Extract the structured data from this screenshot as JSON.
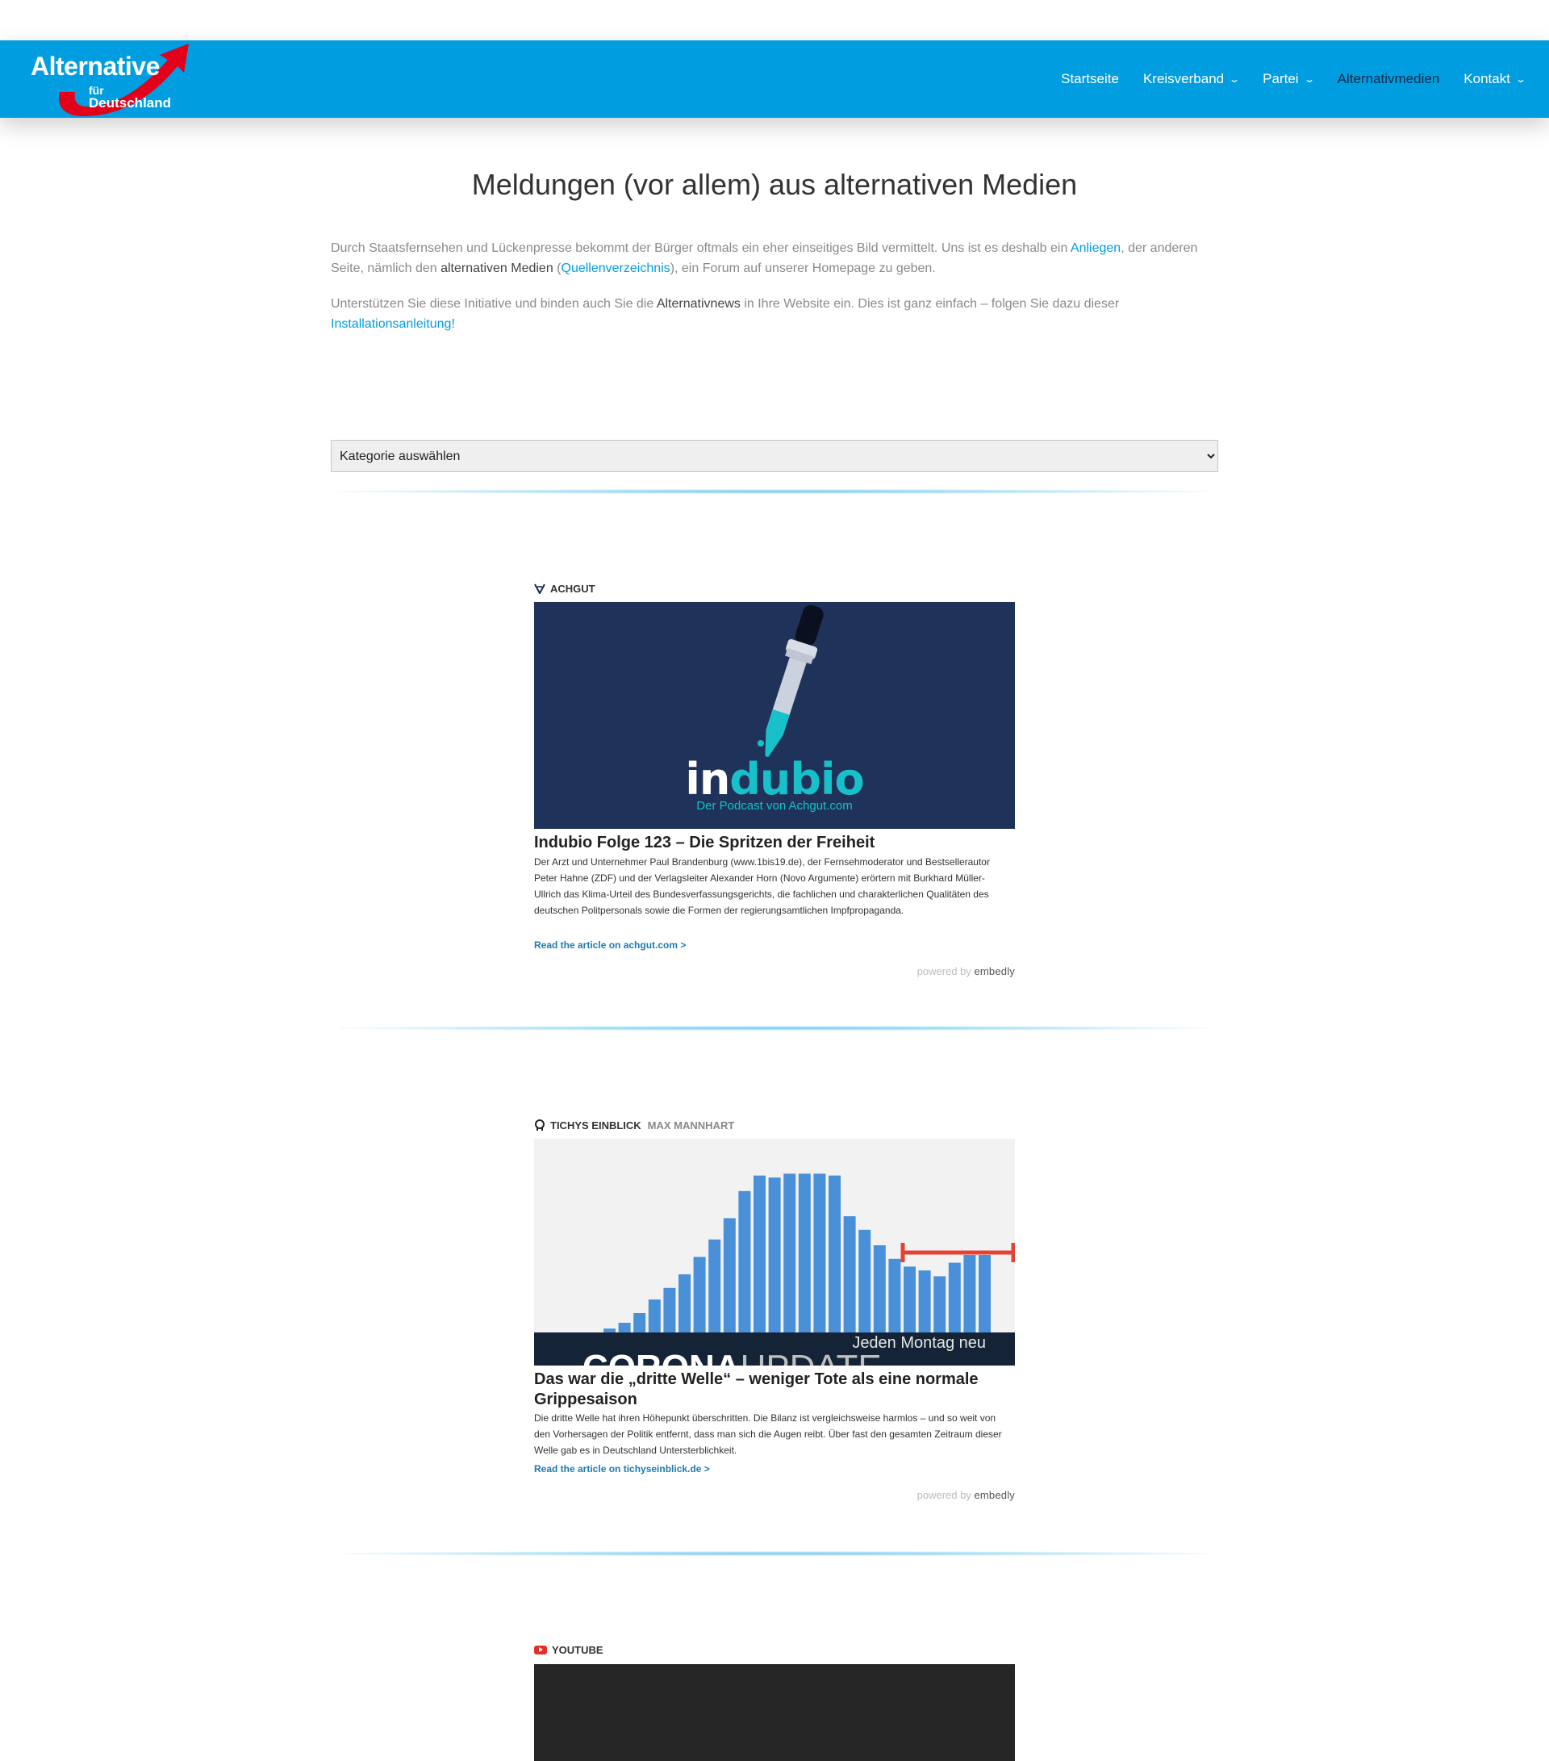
{
  "header": {
    "logo": {
      "line1": "Alternative",
      "line2": "für",
      "line3": "Deutschland"
    },
    "nav": [
      {
        "label": "Startseite",
        "has_dropdown": false,
        "active": false
      },
      {
        "label": "Kreisverband",
        "has_dropdown": true,
        "active": false
      },
      {
        "label": "Partei",
        "has_dropdown": true,
        "active": false
      },
      {
        "label": "Alternativmedien",
        "has_dropdown": false,
        "active": true
      },
      {
        "label": "Kontakt",
        "has_dropdown": true,
        "active": false
      }
    ]
  },
  "page": {
    "title": "Meldungen (vor allem) aus alternativen Medien",
    "intro1": {
      "t1": "Durch Staatsfernsehen und Lückenpresse bekommt der Bürger oftmals ein eher einseitiges Bild vermittelt. Uns ist es deshalb ein ",
      "link1": "Anliegen",
      "t2": ", der anderen Seite, nämlich den ",
      "strong": "alternativen Medien",
      "t3": " (",
      "link2": "Quellenverzeichnis",
      "t4": "), ein Forum auf unserer Homepage zu geben."
    },
    "intro2": {
      "t1": "Unterstützen Sie diese Initiative und binden auch Sie die ",
      "strong": "Alternativnews",
      "t2": " in Ihre Website ein. Dies ist ganz einfach – folgen Sie dazu dieser ",
      "link": "Installationsanleitung!"
    },
    "category_select": {
      "selected": "Kategorie auswählen"
    }
  },
  "cards": [
    {
      "provider": "ACHGUT",
      "author": "",
      "icon": "achgut-icon",
      "thumb": {
        "brand_in": "in",
        "brand_dubio": "dubio",
        "subtitle": "Der Podcast von Achgut.com"
      },
      "title": "Indubio Folge 123 – Die Spritzen der Freiheit",
      "description": "Der Arzt und Unternehmer Paul Brandenburg (www.1bis19.de), der Fernsehmoderator und Bestsellerautor Peter Hahne (ZDF) und der Verlagsleiter Alexander Horn (Novo Argumente) erörtern mit Burkhard Müller-Ullrich das Klima-Urteil des Bundesverfassungsgerichts, die fachlichen und charakterlichen Qualitäten des deutschen Politpersonals sowie die Formen der regierungsamtlichen Impfpropaganda.",
      "link": "Read the article on achgut.com >",
      "powered_prefix": "powered by",
      "powered_brand": "embedly"
    },
    {
      "provider": "TICHYS EINBLICK",
      "author": "MAX MANNHART",
      "icon": "tichys-einblick-icon",
      "thumb": {
        "banner_text": "Jeden Montag neu",
        "banner_word1": "CORONA",
        "banner_word2": "UPDATE"
      },
      "title": "Das war die „dritte Welle“ – weniger Tote als eine normale Grippesaison",
      "description": "Die dritte Welle hat ihren Höhepunkt überschritten. Die Bilanz ist vergleichsweise harmlos – und so weit von den Vorhersagen der Politik entfernt, dass man sich die Augen reibt. Über fast den gesamten Zeitraum dieser Welle gab es in Deutschland Untersterblichkeit.",
      "link": "Read the article on tichyseinblick.de >",
      "powered_prefix": "powered by",
      "powered_brand": "embedly"
    },
    {
      "provider": "YOUTUBE",
      "author": "",
      "icon": "youtube-icon"
    }
  ],
  "chart_data": {
    "type": "bar",
    "title": "",
    "xlabel": "",
    "ylabel": "",
    "values": [
      2,
      5,
      10,
      17,
      23,
      30,
      39,
      48,
      59,
      73,
      81,
      80,
      82,
      82,
      82,
      81,
      60,
      53,
      45,
      38,
      34,
      32,
      29,
      36,
      40,
      40
    ],
    "ylim": [
      0,
      100
    ],
    "annotation_color": "#e34234",
    "bar_color": "#4a90d9"
  }
}
